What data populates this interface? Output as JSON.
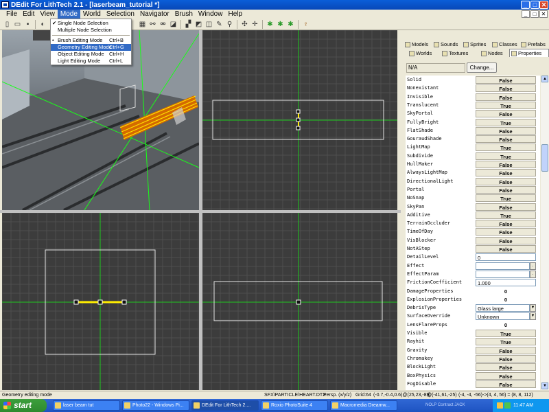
{
  "window": {
    "title": "DEdit For LithTech 2.1 - [laserbeam_tutorial *]",
    "controls": {
      "minimize": "_",
      "maximize": "□",
      "close": "✕"
    }
  },
  "menubar": {
    "items": [
      "File",
      "Edit",
      "View",
      "Mode",
      "World",
      "Selection",
      "Navigator",
      "Brush",
      "Window",
      "Help"
    ],
    "active": "Mode"
  },
  "mode_menu": {
    "items": [
      {
        "label": "Single Node Selection",
        "shortcut": "",
        "checked": true
      },
      {
        "label": "Multiple Node Selection",
        "shortcut": ""
      },
      {
        "label": "Brush Editing Mode",
        "shortcut": "Ctrl+B",
        "bullet": true
      },
      {
        "label": "Geometry Editing Mode",
        "shortcut": "Ctrl+G",
        "highlighted": true
      },
      {
        "label": "Object Editing Mode",
        "shortcut": "Ctrl+H"
      },
      {
        "label": "Light Editing Mode",
        "shortcut": "Ctrl+L"
      }
    ]
  },
  "panel": {
    "tabs_row1": [
      "Models",
      "Sounds",
      "Sprites",
      "Classes",
      "Prefabs"
    ],
    "tabs_row2": [
      "Worlds",
      "Textures",
      "Nodes",
      "Properties"
    ],
    "selected_tab": "Properties",
    "texture_field": "N/A",
    "change_button": "Change...",
    "properties": [
      {
        "name": "Solid",
        "value": "False"
      },
      {
        "name": "Nonexistant",
        "value": "False"
      },
      {
        "name": "Invisible",
        "value": "False"
      },
      {
        "name": "Translucent",
        "value": "True"
      },
      {
        "name": "SkyPortal",
        "value": "False"
      },
      {
        "name": "FullyBright",
        "value": "True"
      },
      {
        "name": "FlatShade",
        "value": "False"
      },
      {
        "name": "GouraudShade",
        "value": "False"
      },
      {
        "name": "LightMap",
        "value": "True"
      },
      {
        "name": "Subdivide",
        "value": "True"
      },
      {
        "name": "HullMaker",
        "value": "False"
      },
      {
        "name": "AlwaysLightMap",
        "value": "False"
      },
      {
        "name": "DirectionalLight",
        "value": "False"
      },
      {
        "name": "Portal",
        "value": "False"
      },
      {
        "name": "NoSnap",
        "value": "True"
      },
      {
        "name": "SkyPan",
        "value": "False"
      },
      {
        "name": "Additive",
        "value": "True"
      },
      {
        "name": "TerrainOccluder",
        "value": "False"
      },
      {
        "name": "TimeOfDay",
        "value": "False"
      },
      {
        "name": "VisBlocker",
        "value": "False"
      },
      {
        "name": "NotAStep",
        "value": "False"
      },
      {
        "name": "DetailLevel",
        "value": "0",
        "kind": "text"
      },
      {
        "name": "Effect",
        "value": "",
        "kind": "text-btn"
      },
      {
        "name": "EffectParam",
        "value": "",
        "kind": "text-btn"
      },
      {
        "name": "FrictionCoefficient",
        "value": "1.000",
        "kind": "text"
      },
      {
        "name": "DamageProperties",
        "value": "0",
        "kind": "plain"
      },
      {
        "name": "ExplosionProperties",
        "value": "0",
        "kind": "plain"
      },
      {
        "name": "DebrisType",
        "value": "Glass large",
        "kind": "select"
      },
      {
        "name": "SurfaceOverride",
        "value": "Unknown",
        "kind": "select"
      },
      {
        "name": "LensFlareProps",
        "value": "0",
        "kind": "plain"
      },
      {
        "name": "Visible",
        "value": "True"
      },
      {
        "name": "Rayhit",
        "value": "True"
      },
      {
        "name": "Gravity",
        "value": "False"
      },
      {
        "name": "Chromakey",
        "value": "False"
      },
      {
        "name": "BlockLight",
        "value": "False"
      },
      {
        "name": "BoxPhysics",
        "value": "False"
      },
      {
        "name": "FogDisable",
        "value": "False"
      }
    ]
  },
  "statusbar": {
    "message": "Geometry editing mode",
    "texture": "SFX\\PARTICLE\\HEART.DTX",
    "view": "Persp. (x/y/z)",
    "grid": "Grid:64",
    "coords1": "(-0.7,-0.4,0.6)@(25,23,-89)",
    "coords2": "@(-41,61,-25)",
    "coords3": "(-4, -4, -56)->(4, 4, 56) = (8, 8, 112)"
  },
  "taskbar": {
    "start": "start",
    "tasks": [
      {
        "label": "laser beam tut"
      },
      {
        "label": "Photo22 - Windows Pi..."
      },
      {
        "label": "DEdit For LithTech 2....",
        "active": true
      },
      {
        "label": "Roxio PhotoSuite 4"
      },
      {
        "label": "Macromedia Dreamw..."
      }
    ],
    "tray_labels": "NOLP  Contract JACK",
    "clock": "11:47 AM"
  }
}
